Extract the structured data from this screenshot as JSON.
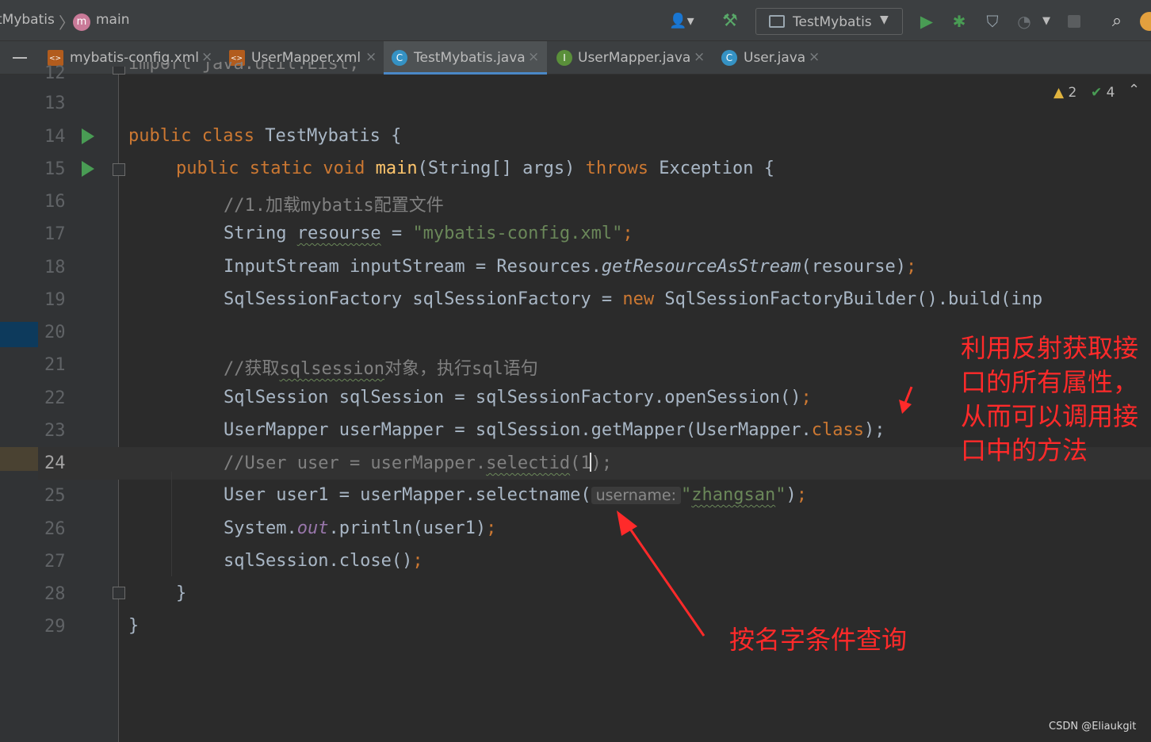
{
  "navbar": {
    "project": "tMybatis",
    "branch_icon_letter": "m",
    "branch": "main",
    "run_config": "TestMybatis",
    "icons": [
      "user-icon",
      "build-hammer-icon",
      "run-icon",
      "debug-icon",
      "coverage-icon",
      "profile-icon",
      "stop-icon",
      "search-icon",
      "update-icon"
    ]
  },
  "tabs": [
    {
      "label": "mybatis-config.xml",
      "icon": "xml-file-icon",
      "active": false
    },
    {
      "label": "UserMapper.xml",
      "icon": "xml-file-icon",
      "active": false
    },
    {
      "label": "TestMybatis.java",
      "icon": "class-file-icon",
      "icon_letter": "C",
      "active": true
    },
    {
      "label": "UserMapper.java",
      "icon": "interface-file-icon",
      "icon_letter": "I",
      "active": false
    },
    {
      "label": "User.java",
      "icon": "class-file-icon",
      "icon_letter": "C",
      "active": false
    }
  ],
  "inspections": {
    "warnings": "2",
    "ok": "4"
  },
  "editor": {
    "line_numbers": [
      "12",
      "13",
      "14",
      "15",
      "16",
      "17",
      "18",
      "19",
      "20",
      "21",
      "22",
      "23",
      "24",
      "25",
      "26",
      "27",
      "28",
      "29"
    ],
    "current_line": "24",
    "top_partial": "import java.util.List;",
    "l14": {
      "kw": "public class",
      "name": "TestMybatis",
      "brace": " {"
    },
    "l15": {
      "kw1": "public static void",
      "fn": "main",
      "sig": "(String[] args) ",
      "kw2": "throws",
      "rest": " Exception {"
    },
    "l16": {
      "comment": "//1.加载mybatis配置文件"
    },
    "l17": {
      "a": "String ",
      "var": "resourse",
      "b": " = ",
      "str": "\"mybatis-config.xml\"",
      "semi": ";"
    },
    "l18": {
      "a": "InputStream inputStream = Resources.",
      "it": "getResourceAsStream",
      "b": "(resourse)",
      "semi": ";"
    },
    "l19": {
      "a": "SqlSessionFactory sqlSessionFactory = ",
      "kw": "new",
      "b": " SqlSessionFactoryBuilder().build(inp"
    },
    "l21": {
      "c1": "//获取",
      "c2": "sqlsession",
      "c3": "对象，执行sql语句"
    },
    "l22": {
      "a": "SqlSession sqlSession = sqlSessionFactory.openSession()",
      "semi": ";"
    },
    "l23": {
      "a": "UserMapper userMapper = sqlSession.getMapper(UserMapper.",
      "kw": "class",
      "b": ");"
    },
    "l24": {
      "c1": "//User user = userMapper.",
      "c2": "selectid",
      "c3": "(1",
      "c4": ");"
    },
    "l25": {
      "a": "User user1 = userMapper.selectname(",
      "hint": "username:",
      "q1": "\"",
      "str": "zhangsan",
      "q2": "\"",
      "b": ")",
      "semi": ";"
    },
    "l26": {
      "a": "System.",
      "fld": "out",
      "b": ".println(user1)",
      "semi": ";"
    },
    "l27": {
      "a": "sqlSession.close()",
      "semi": ";"
    },
    "l28": {
      "a": "}"
    },
    "l29": {
      "a": "}"
    }
  },
  "annotations": {
    "right": "利用反射获取接口的所有属性，从而可以调用接口中的方法",
    "bottom": "按名字条件查询",
    "color": "#ff2a2a"
  },
  "watermark": "CSDN @Eliaukgit",
  "colors": {
    "keyword": "#cc7832",
    "string": "#6a8759",
    "comment": "#808080",
    "function": "#ffc66d",
    "text": "#a9b7c6",
    "run": "#499c54"
  }
}
